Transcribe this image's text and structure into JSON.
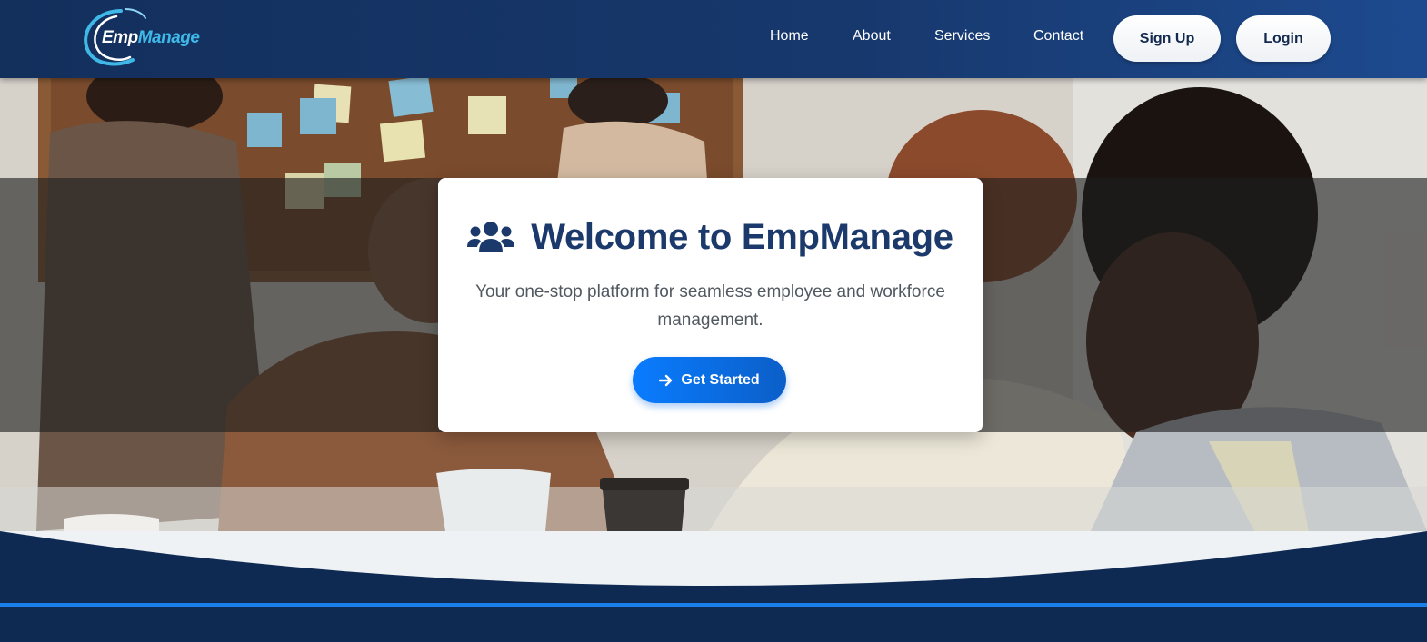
{
  "brand": {
    "logo_part1": "Emp",
    "logo_part2": "Manage"
  },
  "nav": {
    "links": [
      "Home",
      "About",
      "Services",
      "Contact"
    ],
    "signup_label": "Sign Up",
    "login_label": "Login"
  },
  "hero": {
    "title": "Welcome to EmpManage",
    "subtitle": "Your one-stop platform for seamless employee and workforce management.",
    "cta_label": "Get Started",
    "title_icon": "users-icon",
    "cta_icon": "arrow-right-icon"
  },
  "colors": {
    "nav_bg": "#17386d",
    "accent": "#0a7cff",
    "title": "#1b3a6b",
    "footer": "#0f2a52"
  }
}
